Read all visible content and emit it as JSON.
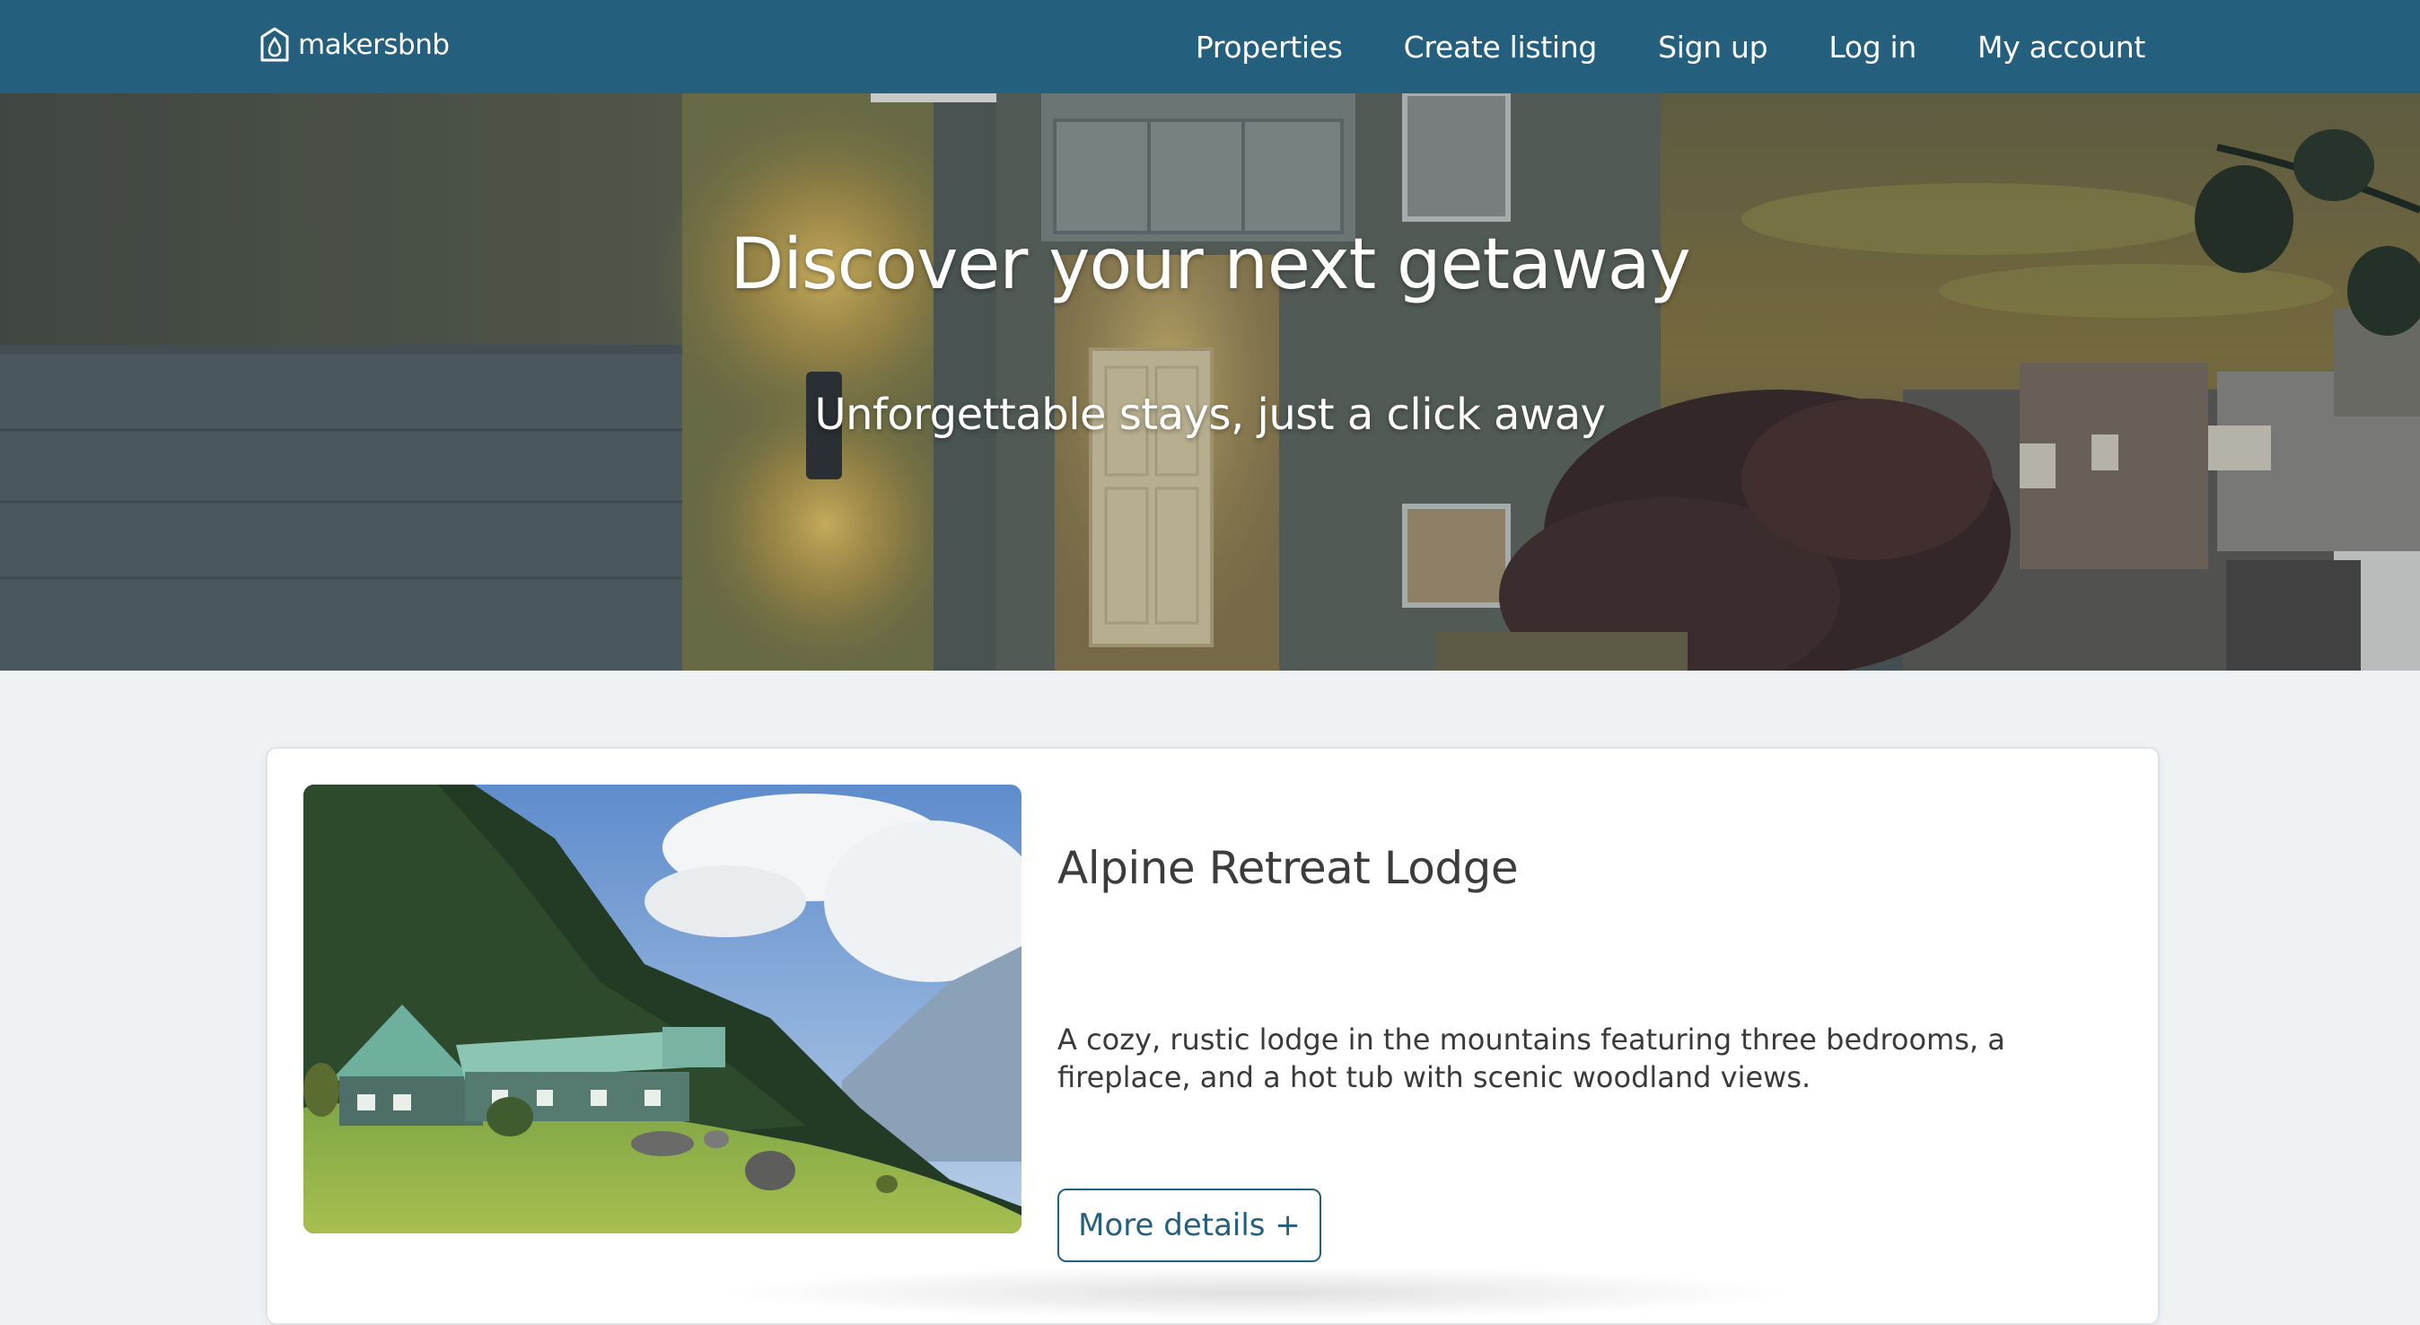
{
  "brand": {
    "name": "makersbnb",
    "icon": "house-drop-icon"
  },
  "nav": {
    "items": [
      {
        "label": "Properties"
      },
      {
        "label": "Create listing"
      },
      {
        "label": "Sign up"
      },
      {
        "label": "Log in"
      },
      {
        "label": "My account"
      }
    ]
  },
  "hero": {
    "title": "Discover your next getaway",
    "subtitle": "Unforgettable stays, just a click away"
  },
  "listings": [
    {
      "title": "Alpine Retreat Lodge",
      "description": "A cozy, rustic lodge in the mountains featuring three bedrooms, a fireplace, and a hot tub with scenic woodland views.",
      "button_label": "More details +"
    }
  ],
  "colors": {
    "navbar": "#245f7d",
    "page_background": "#eef2f5",
    "button_accent": "#245f7d"
  }
}
